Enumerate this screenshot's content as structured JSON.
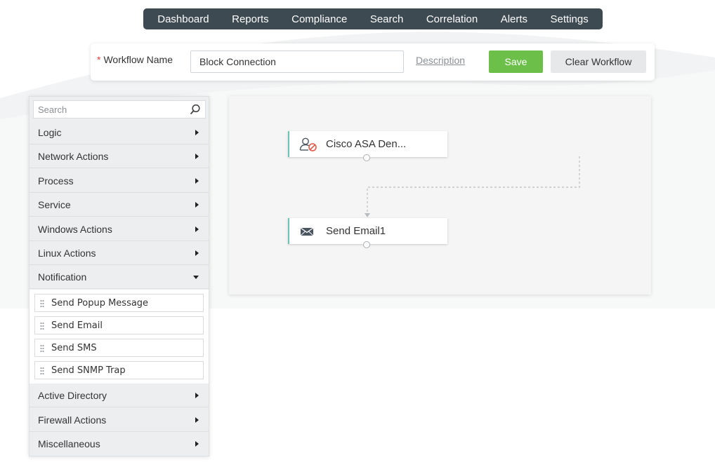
{
  "nav": {
    "items": [
      "Dashboard",
      "Reports",
      "Compliance",
      "Search",
      "Correlation",
      "Alerts",
      "Settings"
    ]
  },
  "workflow": {
    "required_mark": "*",
    "name_label": "Workflow Name",
    "name_value": "Block Connection",
    "description_link": "Description",
    "save_label": "Save",
    "clear_label": "Clear Workflow"
  },
  "sidebar": {
    "search_placeholder": "Search",
    "categories_top": [
      {
        "label": "Logic",
        "expanded": false
      },
      {
        "label": "Network Actions",
        "expanded": false
      },
      {
        "label": "Process",
        "expanded": false
      },
      {
        "label": "Service",
        "expanded": false
      },
      {
        "label": "Windows Actions",
        "expanded": false
      },
      {
        "label": "Linux Actions",
        "expanded": false
      },
      {
        "label": "Notification",
        "expanded": true
      }
    ],
    "notification_actions": [
      "Send Popup Message",
      "Send Email",
      "Send SMS",
      "Send SNMP Trap"
    ],
    "categories_bottom": [
      {
        "label": "Active Directory",
        "expanded": false
      },
      {
        "label": "Firewall Actions",
        "expanded": false
      },
      {
        "label": "Miscellaneous",
        "expanded": false
      }
    ]
  },
  "canvas": {
    "nodes": [
      {
        "label": "Cisco ASA Den...",
        "icon": "user-block-icon"
      },
      {
        "label": "Send Email1",
        "icon": "envelope-icon"
      }
    ]
  },
  "colors": {
    "nav_bg": "#3e4a52",
    "save_green": "#6cc04a",
    "node_accent": "#6ec5b4",
    "block_red": "#e05a4a"
  }
}
